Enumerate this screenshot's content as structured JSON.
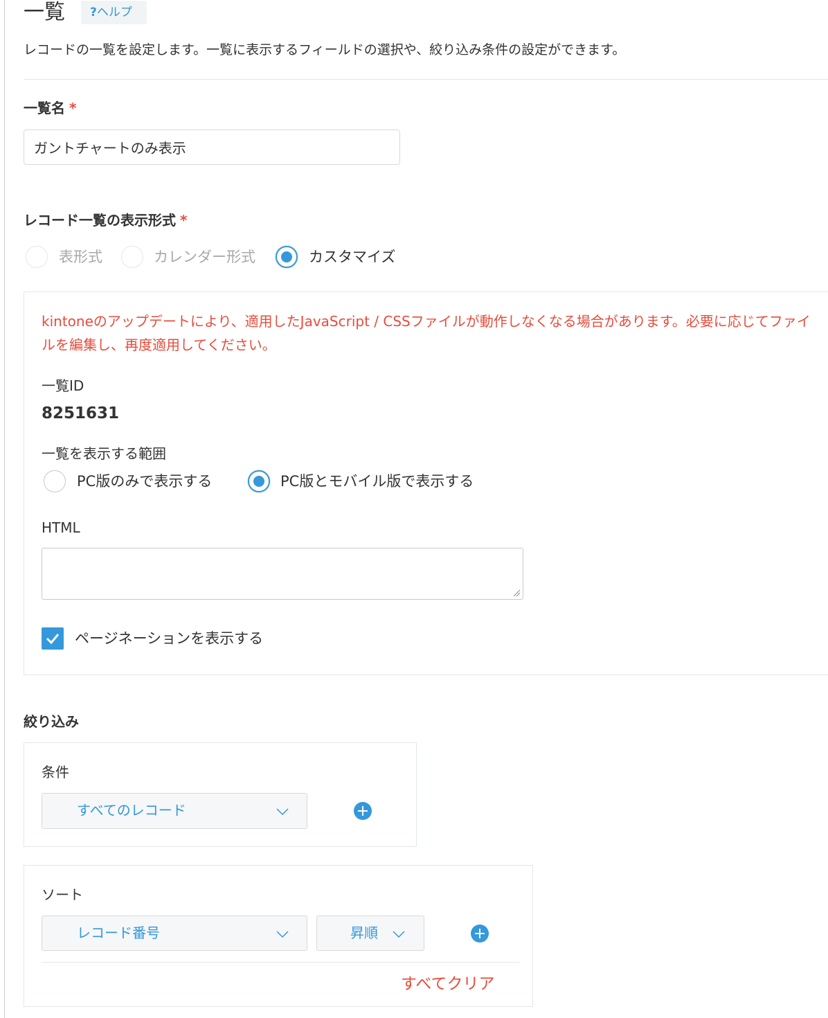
{
  "header": {
    "title": "一覧",
    "help_label": "ヘルプ",
    "help_icon": "?",
    "description": "レコードの一覧を設定します。一覧に表示するフィールドの選択や、絞り込み条件の設定ができます。"
  },
  "view_name": {
    "label": "一覧名",
    "required_mark": "*",
    "value": "ガントチャートのみ表示"
  },
  "display_format": {
    "label": "レコード一覧の表示形式",
    "required_mark": "*",
    "options": [
      {
        "label": "表形式",
        "selected": false,
        "disabled": true
      },
      {
        "label": "カレンダー形式",
        "selected": false,
        "disabled": true
      },
      {
        "label": "カスタマイズ",
        "selected": true,
        "disabled": false
      }
    ]
  },
  "custom_panel": {
    "warning": "kintoneのアップデートにより、適用したJavaScript / CSSファイルが動作しなくなる場合があります。必要に応じてファイルを編集し、再度適用してください。",
    "view_id_label": "一覧ID",
    "view_id_value": "8251631",
    "scope_label": "一覧を表示する範囲",
    "scope_options": [
      {
        "label": "PC版のみで表示する",
        "selected": false
      },
      {
        "label": "PC版とモバイル版で表示する",
        "selected": true
      }
    ],
    "html_label": "HTML",
    "html_value": "",
    "pagination_label": "ページネーションを表示する",
    "pagination_checked": true
  },
  "filter": {
    "label": "絞り込み",
    "condition_label": "条件",
    "condition_value": "すべてのレコード"
  },
  "sort": {
    "label": "ソート",
    "field_value": "レコード番号",
    "order_value": "昇順",
    "clear_label": "すべてクリア"
  },
  "colors": {
    "accent": "#3498db",
    "error": "#e74c3c",
    "text": "#333333",
    "border": "#e3e7e8"
  }
}
